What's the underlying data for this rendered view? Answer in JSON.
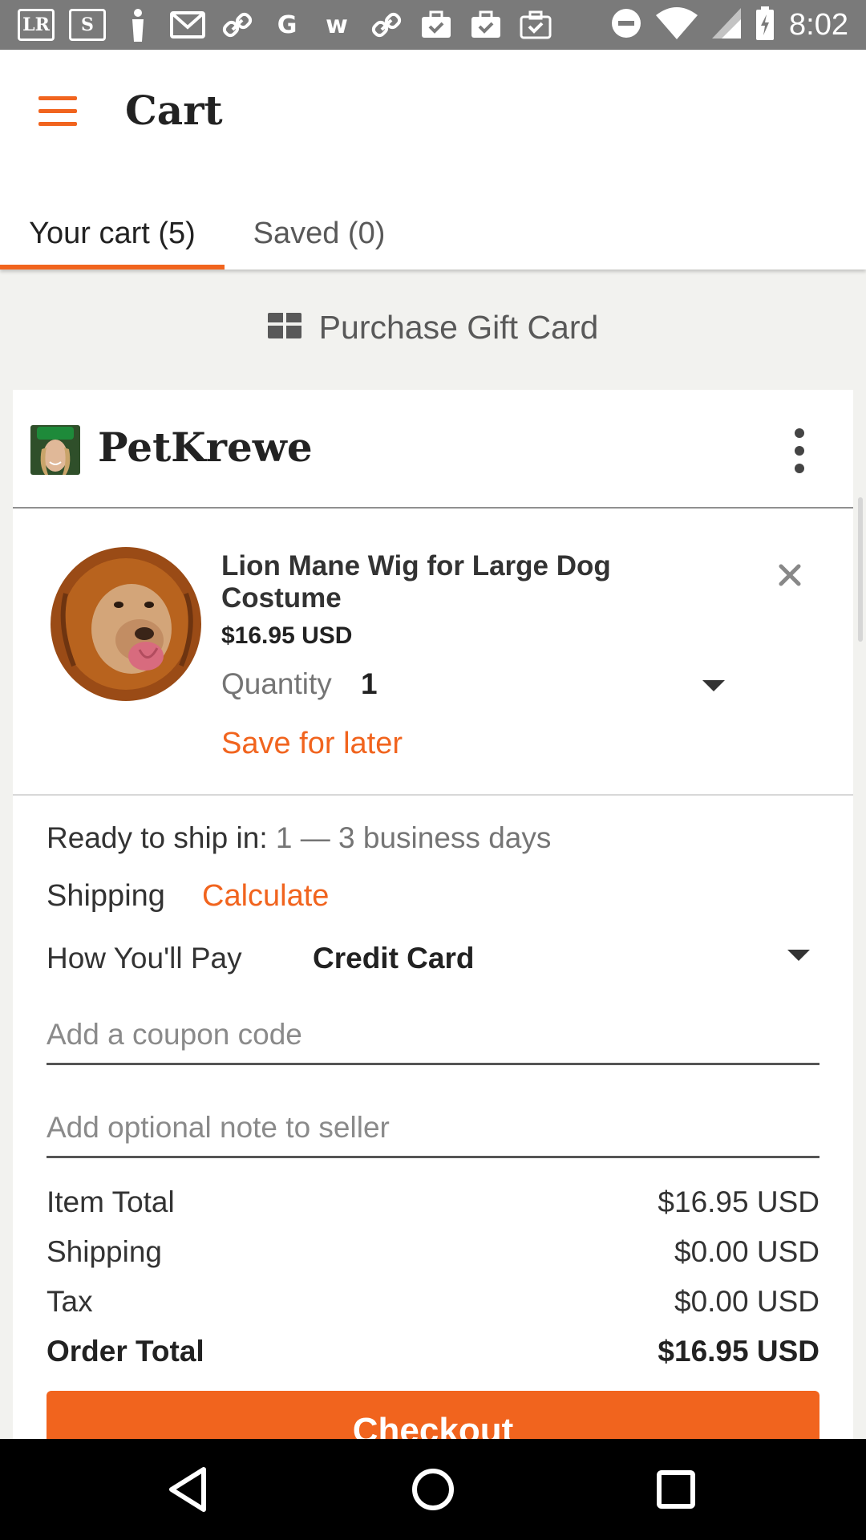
{
  "status_bar": {
    "time": "8:02",
    "notification_icons": [
      "lr-icon",
      "s-app-icon",
      "app-icon",
      "gmail-icon",
      "link-icon",
      "google-icon",
      "w-icon",
      "link-icon",
      "briefcase-check-icon",
      "briefcase-check-icon",
      "briefcase-check-icon"
    ],
    "lr_text": "LR",
    "s_text": "S",
    "g_text": "G",
    "w_text": "w"
  },
  "header": {
    "title": "Cart",
    "tabs": [
      {
        "label": "Your cart (5)",
        "active": true
      },
      {
        "label": "Saved (0)",
        "active": false
      }
    ]
  },
  "gift_card": {
    "label": "Purchase Gift Card"
  },
  "shop": {
    "name": "PetKrewe",
    "item": {
      "title": "Lion Mane Wig for Large Dog Costume",
      "price": "$16.95 USD",
      "quantity_label": "Quantity",
      "quantity_value": "1",
      "save_for_later": "Save for later"
    },
    "ready_to_ship_label": "Ready to ship in:",
    "ready_to_ship_value": "1 — 3 business days",
    "shipping_label": "Shipping",
    "shipping_action": "Calculate",
    "payment_label": "How You'll Pay",
    "payment_value": "Credit Card",
    "coupon_placeholder": "Add a coupon code",
    "note_placeholder": "Add optional note to seller",
    "summary": [
      {
        "label": "Item Total",
        "value": "$16.95 USD"
      },
      {
        "label": "Shipping",
        "value": "$0.00 USD"
      },
      {
        "label": "Tax",
        "value": "$0.00 USD"
      },
      {
        "label": "Order Total",
        "value": "$16.95 USD"
      }
    ],
    "checkout_label": "Checkout"
  },
  "colors": {
    "accent": "#f1641e",
    "status_bar": "#7a7a7a",
    "background": "#f2f2ef"
  }
}
